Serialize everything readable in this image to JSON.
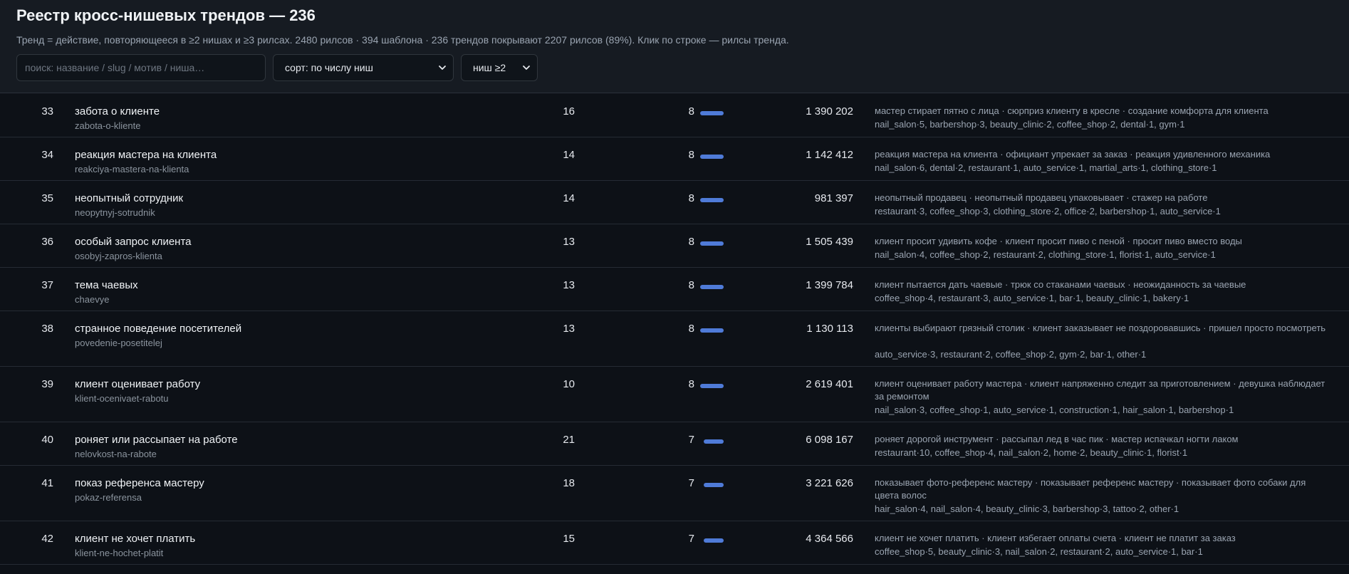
{
  "header": {
    "title": "Реестр кросс-нишевых трендов — 236",
    "subtitle": "Тренд = действие, повторяющееся в ≥2 нишах и ≥3 рилсах. 2480 рилсов · 394 шаблона · 236 трендов покрывают 2207 рилсов (89%). Клик по строке — рилсы тренда."
  },
  "controls": {
    "search_placeholder": "поиск: название / slug / мотив / ниша…",
    "sort_value": "сорт: по числу ниш",
    "niches_value": "ниш ≥2"
  },
  "accent_color": "#4f7bd8",
  "rows": [
    {
      "idx": "33",
      "name": "забота о клиенте",
      "slug": "zabota-o-kliente",
      "reels": "16",
      "niches": "8",
      "niche_fraction": 0.8,
      "views": "1 390 202",
      "motifs": "мастер стирает пятно с лица · сюрприз клиенту в кресле · создание комфорта для клиента",
      "niche_list": "nail_salon·5, barbershop·3, beauty_clinic·2, coffee_shop·2, dental·1, gym·1"
    },
    {
      "idx": "34",
      "name": "реакция мастера на клиента",
      "slug": "reakciya-mastera-na-klienta",
      "reels": "14",
      "niches": "8",
      "niche_fraction": 0.8,
      "views": "1 142 412",
      "motifs": "реакция мастера на клиента · официант упрекает за заказ · реакция удивленного механика",
      "niche_list": "nail_salon·6, dental·2, restaurant·1, auto_service·1, martial_arts·1, clothing_store·1"
    },
    {
      "idx": "35",
      "name": "неопытный сотрудник",
      "slug": "neopytnyj-sotrudnik",
      "reels": "14",
      "niches": "8",
      "niche_fraction": 0.8,
      "views": "981 397",
      "motifs": "неопытный продавец · неопытный продавец упаковывает · стажер на работе",
      "niche_list": "restaurant·3, coffee_shop·3, clothing_store·2, office·2, barbershop·1, auto_service·1"
    },
    {
      "idx": "36",
      "name": "особый запрос клиента",
      "slug": "osobyj-zapros-klienta",
      "reels": "13",
      "niches": "8",
      "niche_fraction": 0.8,
      "views": "1 505 439",
      "motifs": "клиент просит удивить кофе · клиент просит пиво с пеной · просит пиво вместо воды",
      "niche_list": "nail_salon·4, coffee_shop·2, restaurant·2, clothing_store·1, florist·1, auto_service·1"
    },
    {
      "idx": "37",
      "name": "тема чаевых",
      "slug": "chaevye",
      "reels": "13",
      "niches": "8",
      "niche_fraction": 0.8,
      "views": "1 399 784",
      "motifs": "клиент пытается дать чаевые · трюк со стаканами чаевых · неожиданность за чаевые",
      "niche_list": "coffee_shop·4, restaurant·3, auto_service·1, bar·1, beauty_clinic·1, bakery·1"
    },
    {
      "idx": "38",
      "name": "странное поведение посетителей",
      "slug": "povedenie-posetitelej",
      "reels": "13",
      "niches": "8",
      "niche_fraction": 0.8,
      "views": "1 130 113",
      "motifs": "клиенты выбирают грязный столик · клиент заказывает не поздоровавшись · пришел просто посмотреть",
      "niche_list": "auto_service·3, restaurant·2, coffee_shop·2, gym·2, bar·1, other·1"
    },
    {
      "idx": "39",
      "name": "клиент оценивает работу",
      "slug": "klient-ocenivaet-rabotu",
      "reels": "10",
      "niches": "8",
      "niche_fraction": 0.8,
      "views": "2 619 401",
      "motifs": "клиент оценивает работу мастера · клиент напряженно следит за приготовлением · девушка наблюдает за ремонтом",
      "niche_list": "nail_salon·3, coffee_shop·1, auto_service·1, construction·1, hair_salon·1, barbershop·1"
    },
    {
      "idx": "40",
      "name": "роняет или рассыпает на работе",
      "slug": "nelovkost-na-rabote",
      "reels": "21",
      "niches": "7",
      "niche_fraction": 0.7,
      "views": "6 098 167",
      "motifs": "роняет дорогой инструмент · рассыпал лед в час пик · мастер испачкал ногти лаком",
      "niche_list": "restaurant·10, coffee_shop·4, nail_salon·2, home·2, beauty_clinic·1, florist·1"
    },
    {
      "idx": "41",
      "name": "показ референса мастеру",
      "slug": "pokaz-referensa",
      "reels": "18",
      "niches": "7",
      "niche_fraction": 0.7,
      "views": "3 221 626",
      "motifs": "показывает фото-референс мастеру · показывает референс мастеру · показывает фото собаки для цвета волос",
      "niche_list": "hair_salon·4, nail_salon·4, beauty_clinic·3, barbershop·3, tattoo·2, other·1"
    },
    {
      "idx": "42",
      "name": "клиент не хочет платить",
      "slug": "klient-ne-hochet-platit",
      "reels": "15",
      "niches": "7",
      "niche_fraction": 0.7,
      "views": "4 364 566",
      "motifs": "клиент не хочет платить · клиент избегает оплаты счета · клиент не платит за заказ",
      "niche_list": "coffee_shop·5, beauty_clinic·3, nail_salon·2, restaurant·2, auto_service·1, bar·1"
    }
  ]
}
